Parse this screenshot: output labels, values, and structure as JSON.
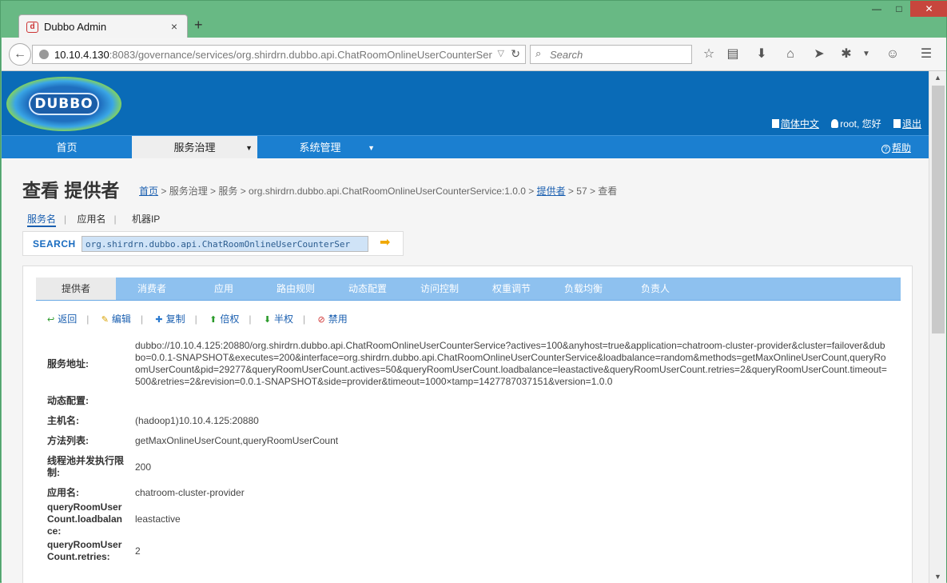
{
  "browser": {
    "tab_title": "Dubbo Admin",
    "tab_close": "×",
    "new_tab": "+",
    "win_minimize": "—",
    "win_maximize": "□",
    "win_close": "✕",
    "url_host": "10.10.4.130",
    "url_rest": ":8083/governance/services/org.shirdrn.dubbo.api.ChatRoomOnlineUserCounterServ",
    "search_placeholder": "Search"
  },
  "header": {
    "logo_text": "DUBBO",
    "lang_link": "简体中文",
    "user_greeting": "root, 您好",
    "logout_link": "退出"
  },
  "menu": {
    "items": [
      "首页",
      "服务治理",
      "系统管理"
    ],
    "help": "帮助"
  },
  "page": {
    "title": "查看 提供者",
    "breadcrumb": {
      "home": "首页",
      "part1": " > 服务治理 > 服务 > org.shirdrn.dubbo.api.ChatRoomOnlineUserCounterService:1.0.0 > ",
      "providers": "提供者",
      "part2": " > 57 > 查看"
    },
    "subtabs": [
      "服务名",
      "应用名",
      "机器IP"
    ],
    "search_label": "SEARCH",
    "search_value": "org.shirdrn.dubbo.api.ChatRoomOnlineUserCounterSer"
  },
  "panel": {
    "tabs": [
      "提供者",
      "消费者",
      "应用",
      "路由规则",
      "动态配置",
      "访问控制",
      "权重调节",
      "负载均衡",
      "负责人"
    ],
    "actions": [
      "返回",
      "编辑",
      "复制",
      "倍权",
      "半权",
      "禁用"
    ],
    "details": [
      {
        "key": "服务地址:",
        "value": "dubbo://10.10.4.125:20880/org.shirdrn.dubbo.api.ChatRoomOnlineUserCounterService?actives=100&anyhost=true&application=chatroom-cluster-provider&cluster=failover&dubbo=0.0.1-SNAPSHOT&executes=200&interface=org.shirdrn.dubbo.api.ChatRoomOnlineUserCounterService&loadbalance=random&methods=getMaxOnlineUserCount,queryRoomUserCount&pid=29277&queryRoomUserCount.actives=50&queryRoomUserCount.loadbalance=leastactive&queryRoomUserCount.retries=2&queryRoomUserCount.timeout=500&retries=2&revision=0.0.1-SNAPSHOT&side=provider&timeout=1000×tamp=1427787037151&version=1.0.0"
      },
      {
        "key": "动态配置:",
        "value": ""
      },
      {
        "key": "主机名:",
        "value": "(hadoop1)10.10.4.125:20880"
      },
      {
        "key": "方法列表:",
        "value": "getMaxOnlineUserCount,queryRoomUserCount"
      },
      {
        "key": "线程池并发执行限制:",
        "value": "200"
      },
      {
        "key": "应用名:",
        "value": "chatroom-cluster-provider"
      },
      {
        "key": "queryRoomUserCount.loadbalance:",
        "value": "leastactive"
      },
      {
        "key": "queryRoomUserCount.retries:",
        "value": "2"
      }
    ]
  }
}
